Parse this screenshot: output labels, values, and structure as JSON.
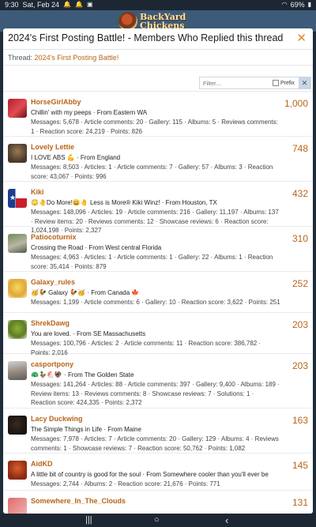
{
  "statusbar": {
    "time": "9:30",
    "date": "Sat, Feb 24",
    "battery": "69%"
  },
  "site": {
    "logo_line1": "BackYard",
    "logo_line2": "Chickens"
  },
  "modal": {
    "title": "2024's First Posting Battle! - Members Who Replied this thread",
    "thread_prefix": "Thread:",
    "thread_link": "2024's First Posting Battle!",
    "filter_placeholder": "Filter...",
    "prefix_label": "Prefix"
  },
  "members": [
    {
      "name": "HorseGirlAbby",
      "title": "Chillin' with my peeps · From Eastern WA",
      "stats": "Messages: 5,678 · Article comments: 20 · Gallery: 115 · Albums: 5 · Reviews comments: 1 · Reaction score: 24,219 · Points: 826",
      "count": "1,000"
    },
    {
      "name": "Lovely Lettie",
      "title": "I LOVE ABS 💪 · From England",
      "stats": "Messages: 8,503 · Articles: 1 · Article comments: 7 · Gallery: 57 · Albums: 3 · Reaction score: 43,067 · Points: 996",
      "count": "748"
    },
    {
      "name": "Kiki",
      "title": "😳🤚Do More!😀🤚 Less is More® Kiki Winz! · From Houston, TX",
      "stats": "Messages: 148,096 · Articles: 19 · Article comments: 216 · Gallery: 11,197 · Albums: 137 · Review items: 20 · Reviews comments: 12 · Showcase reviews: 6 · Reaction score: 1,024,198 · Points: 2,327",
      "count": "432"
    },
    {
      "name": "Patiocoturnix",
      "title": "Crossing the Road · From West central Florida",
      "stats": "Messages: 4,963 · Articles: 1 · Article comments: 1 · Gallery: 22 · Albums: 1 · Reaction score: 35,414 · Points: 879",
      "count": "310"
    },
    {
      "name": "Galaxy_rules",
      "title": "🥳🐓 Galaxy 🐓🥳 · From Canada 🍁",
      "stats": "Messages: 1,199 · Article comments: 6 · Gallery: 10 · Reaction score: 3,622 · Points: 251",
      "count": "252"
    },
    {
      "name": "ShrekDawg",
      "title": "You are loved. · From SE Massachusetts",
      "stats": "Messages: 100,796 · Articles: 2 · Article comments: 11 · Reaction score: 386,782 · Points: 2,016",
      "count": "203"
    },
    {
      "name": "casportpony",
      "title": "🦚🦆🐔🦃 · From The Golden State",
      "stats": "Messages: 141,264 · Articles: 88 · Article comments: 397 · Gallery: 9,400 · Albums: 189 · Review items: 13 · Reviews comments: 8 · Showcase reviews: 7 · Solutions: 1 · Reaction score: 424,335 · Points: 2,372",
      "count": "203"
    },
    {
      "name": "Lacy Duckwing",
      "title": "The Simple Things in Life · From Maine",
      "stats": "Messages: 7,978 · Articles: 7 · Article comments: 20 · Gallery: 129 · Albums: 4 · Reviews comments: 1 · Showcase reviews: 7 · Reaction score: 50,762 · Points: 1,082",
      "count": "163"
    },
    {
      "name": "AidKD",
      "title": "A little bit of country is good for the soul · From Somewhere cooler than you'll ever be",
      "stats": "Messages: 2,744 · Albums: 2 · Reaction score: 21,676 · Points: 771",
      "count": "145"
    },
    {
      "name": "Somewhere_In_The_Clouds",
      "title": "",
      "stats": "",
      "count": "131"
    }
  ],
  "colors": {
    "accent": "#b8651a",
    "close": "#d98a2b"
  },
  "nav": {
    "recent": "|||",
    "home": "○",
    "back": "‹"
  }
}
